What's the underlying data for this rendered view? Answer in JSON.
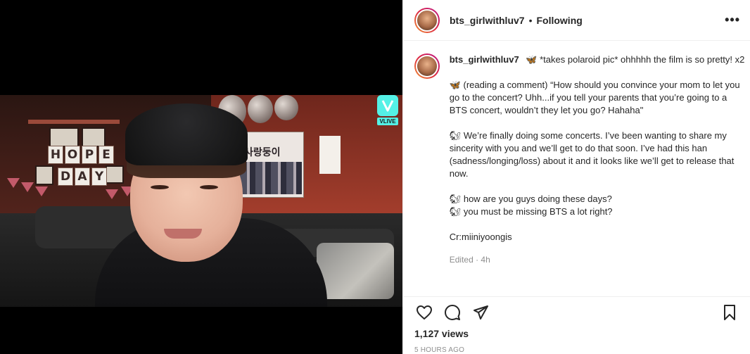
{
  "post": {
    "username": "bts_girlwithluv7",
    "separator": "•",
    "following_label": "Following",
    "more_label": "•••"
  },
  "media": {
    "banner_letters_top": [
      "H",
      "O",
      "P",
      "E"
    ],
    "banner_letters_bottom": [
      "D",
      "A",
      "Y"
    ],
    "poster_text": "사랑둥이",
    "watermark_label": "VLIVE"
  },
  "caption": {
    "username": "bts_girlwithluv7",
    "paragraphs": [
      "🦋 *takes polaroid pic* ohhhhh the film is so pretty! x2",
      "🦋 (reading a comment) “How should you convince your mom to let you go to the concert? Uhh...if you tell your parents that you’re going to a BTS concert, wouldn’t they let you go? Hahaha\"",
      "🐿 We’re finally doing some concerts. I’ve been wanting to share my sincerity with you and we’ll get to do that soon. I’ve had this han (sadness/longing/loss) about it and it looks like we’ll get to release that now.",
      "🐿 how are you guys doing these days?\n🐿 you must be missing BTS a lot right?",
      "Cr:miiniyoongis"
    ],
    "edited_label": "Edited · 4h"
  },
  "actions": {
    "like_icon": "heart-icon",
    "comment_icon": "comment-icon",
    "share_icon": "paper-plane-icon",
    "save_icon": "bookmark-icon"
  },
  "stats": {
    "views": "1,127 views",
    "timestamp": "5 HOURS AGO"
  }
}
